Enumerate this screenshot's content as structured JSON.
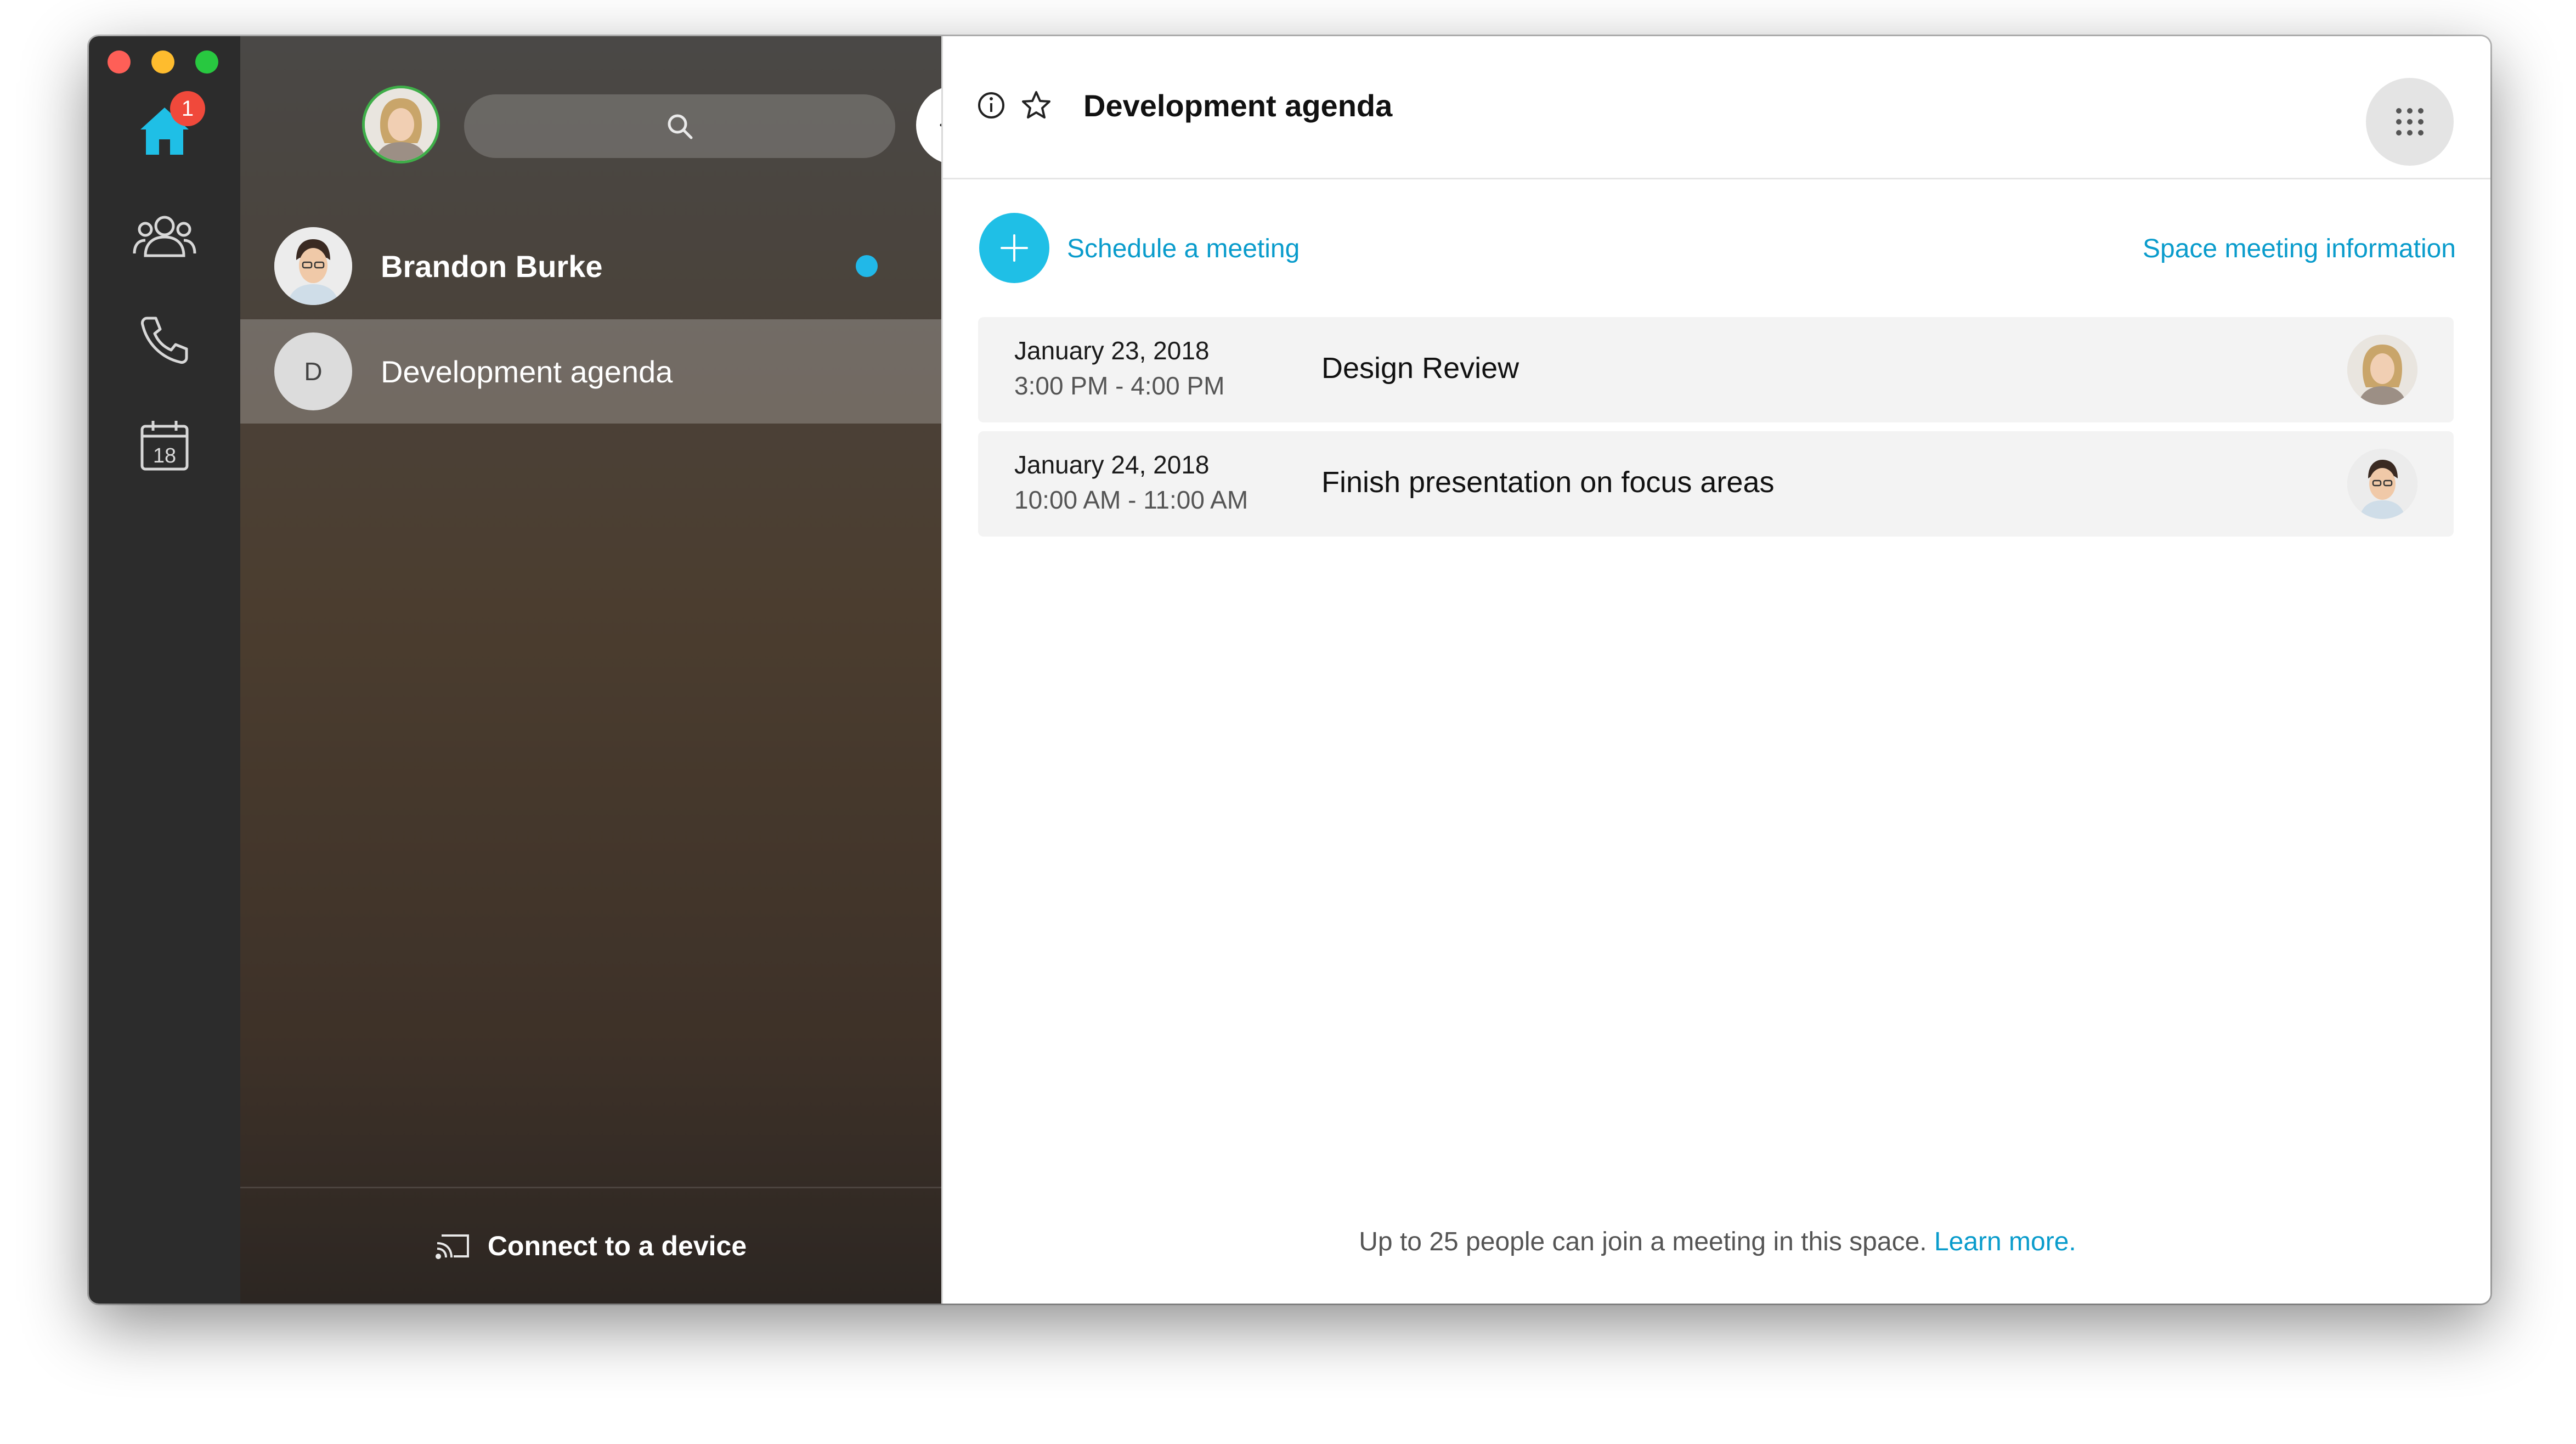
{
  "window": {
    "traffic_lights": [
      "close",
      "minimize",
      "zoom"
    ]
  },
  "rail": {
    "items": [
      {
        "icon": "home-icon",
        "badge": "1"
      },
      {
        "icon": "teams-icon"
      },
      {
        "icon": "phone-icon"
      },
      {
        "icon": "calendar-icon",
        "calendar_day": "18"
      }
    ]
  },
  "list": {
    "search_icon": "search-icon",
    "add_icon": "plus-icon",
    "conversations": [
      {
        "name": "Brandon Burke",
        "unread": true
      },
      {
        "name": "Development agenda",
        "initial": "D",
        "selected": true
      }
    ],
    "footer": {
      "icon": "cast-icon",
      "label": "Connect to a device"
    }
  },
  "main": {
    "title": "Development agenda",
    "schedule_label": "Schedule a meeting",
    "space_info_label": "Space meeting information",
    "meetings": [
      {
        "date": "January 23, 2018",
        "time": "3:00 PM - 4:00 PM",
        "title": "Design Review"
      },
      {
        "date": "January 24, 2018",
        "time": "10:00 AM - 11:00 AM",
        "title": "Finish presentation on focus areas"
      }
    ],
    "footnote": "Up to 25 people can join a meeting in this space.",
    "learn_more": "Learn more."
  },
  "colors": {
    "accent": "#1fbfe6",
    "link": "#0a9ccc",
    "badge": "#f0493b",
    "presence": "#3fae49"
  }
}
